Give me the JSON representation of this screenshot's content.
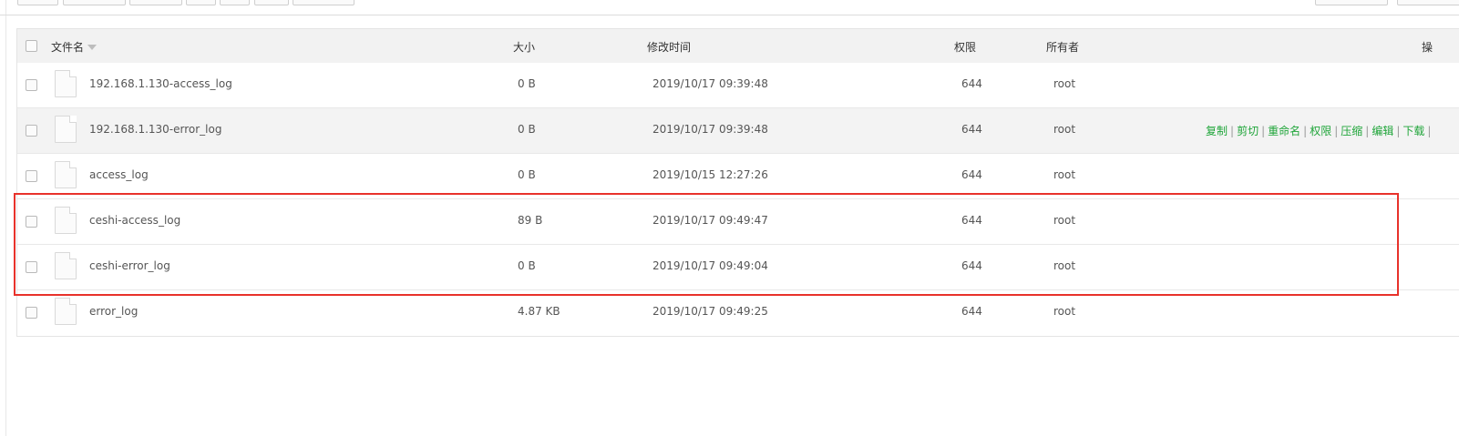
{
  "table": {
    "headers": {
      "name": "文件名",
      "size": "大小",
      "mtime": "修改时间",
      "perm": "权限",
      "owner": "所有者",
      "ops": "操"
    },
    "rows": [
      {
        "name": "192.168.1.130-access_log",
        "size": "0 B",
        "mtime": "2019/10/17 09:39:48",
        "perm": "644",
        "owner": "root"
      },
      {
        "name": "192.168.1.130-error_log",
        "size": "0 B",
        "mtime": "2019/10/17 09:39:48",
        "perm": "644",
        "owner": "root"
      },
      {
        "name": "access_log",
        "size": "0 B",
        "mtime": "2019/10/15 12:27:26",
        "perm": "644",
        "owner": "root"
      },
      {
        "name": "ceshi-access_log",
        "size": "89 B",
        "mtime": "2019/10/17 09:49:47",
        "perm": "644",
        "owner": "root"
      },
      {
        "name": "ceshi-error_log",
        "size": "0 B",
        "mtime": "2019/10/17 09:49:04",
        "perm": "644",
        "owner": "root"
      },
      {
        "name": "error_log",
        "size": "4.87 KB",
        "mtime": "2019/10/17 09:49:25",
        "perm": "644",
        "owner": "root"
      }
    ],
    "row_actions": {
      "copy": "复制",
      "cut": "剪切",
      "rename": "重命名",
      "perm": "权限",
      "compress": "压缩",
      "edit": "编辑",
      "download": "下载",
      "separator": "|"
    }
  },
  "colors": {
    "action_link": "#20a53a",
    "highlight_box": "#e8322b",
    "header_bg": "#f2f2f2",
    "hover_row_bg": "#f3f3f3"
  },
  "icons": {
    "file": "file-icon",
    "sort": "sort-down-icon"
  }
}
